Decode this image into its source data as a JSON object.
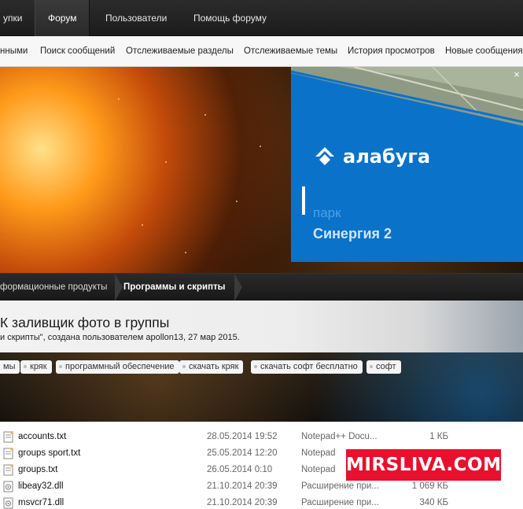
{
  "topnav": {
    "tabs": [
      "упки",
      "Форум",
      "Пользователи",
      "Помощь форуму"
    ],
    "active": "Форум"
  },
  "subnav": {
    "items": [
      "нными",
      "Поиск сообщений",
      "Отслеживаемые разделы",
      "Отслеживаемые темы",
      "История просмотров",
      "Новые сообщения"
    ]
  },
  "ad": {
    "logo": "алабуга",
    "line1": "парк",
    "line2": "Синергия 2",
    "close": "×",
    "colors": {
      "background": "#0b72c9"
    }
  },
  "breadcrumbs": [
    "формационные продукты",
    "Программы и скрипты"
  ],
  "thread": {
    "title": "К заливщик фото в группы",
    "subtitle": "и скрипты\", создана пользователем apollon13, 27 мар 2015."
  },
  "tags": [
    "мы",
    "кряк",
    "программный обеспечение",
    "скачать кряк",
    "скачать софт бесплатно",
    "софт"
  ],
  "files": [
    {
      "name": "accounts.txt",
      "date": "28.05.2014 19:52",
      "type": "Notepad++ Docu...",
      "size": "1 КБ",
      "icon": "text-file-icon"
    },
    {
      "name": "groups sport.txt",
      "date": "25.05.2014 12:20",
      "type": "Notepad",
      "size": "",
      "icon": "text-file-icon"
    },
    {
      "name": "groups.txt",
      "date": "26.05.2014 0:10",
      "type": "Notepad",
      "size": "",
      "icon": "text-file-icon"
    },
    {
      "name": "libeay32.dll",
      "date": "21.10.2014 20:39",
      "type": "Расширение при...",
      "size": "1 069 КБ",
      "icon": "dll-file-icon"
    },
    {
      "name": "msvcr71.dll",
      "date": "21.10.2014 20:39",
      "type": "Расширение при...",
      "size": "340 КБ",
      "icon": "dll-file-icon"
    }
  ],
  "watermark": "MIRSLIVA.COM"
}
